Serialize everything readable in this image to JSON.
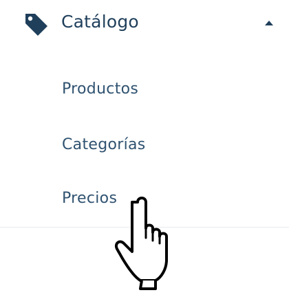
{
  "menu": {
    "header": {
      "label": "Catálogo",
      "icon": "tag-icon",
      "expanded": true,
      "toggle_icon": "chevron-up-icon"
    },
    "items": [
      {
        "label": "Productos"
      },
      {
        "label": "Categorías"
      },
      {
        "label": "Precios"
      }
    ]
  },
  "colors": {
    "header_text": "#1f3f5b",
    "item_text": "#2f5270",
    "icon": "#1f3f5b",
    "divider": "#e8ebee",
    "background": "#ffffff"
  },
  "cursor": {
    "icon": "hand-pointer-cursor-icon"
  }
}
